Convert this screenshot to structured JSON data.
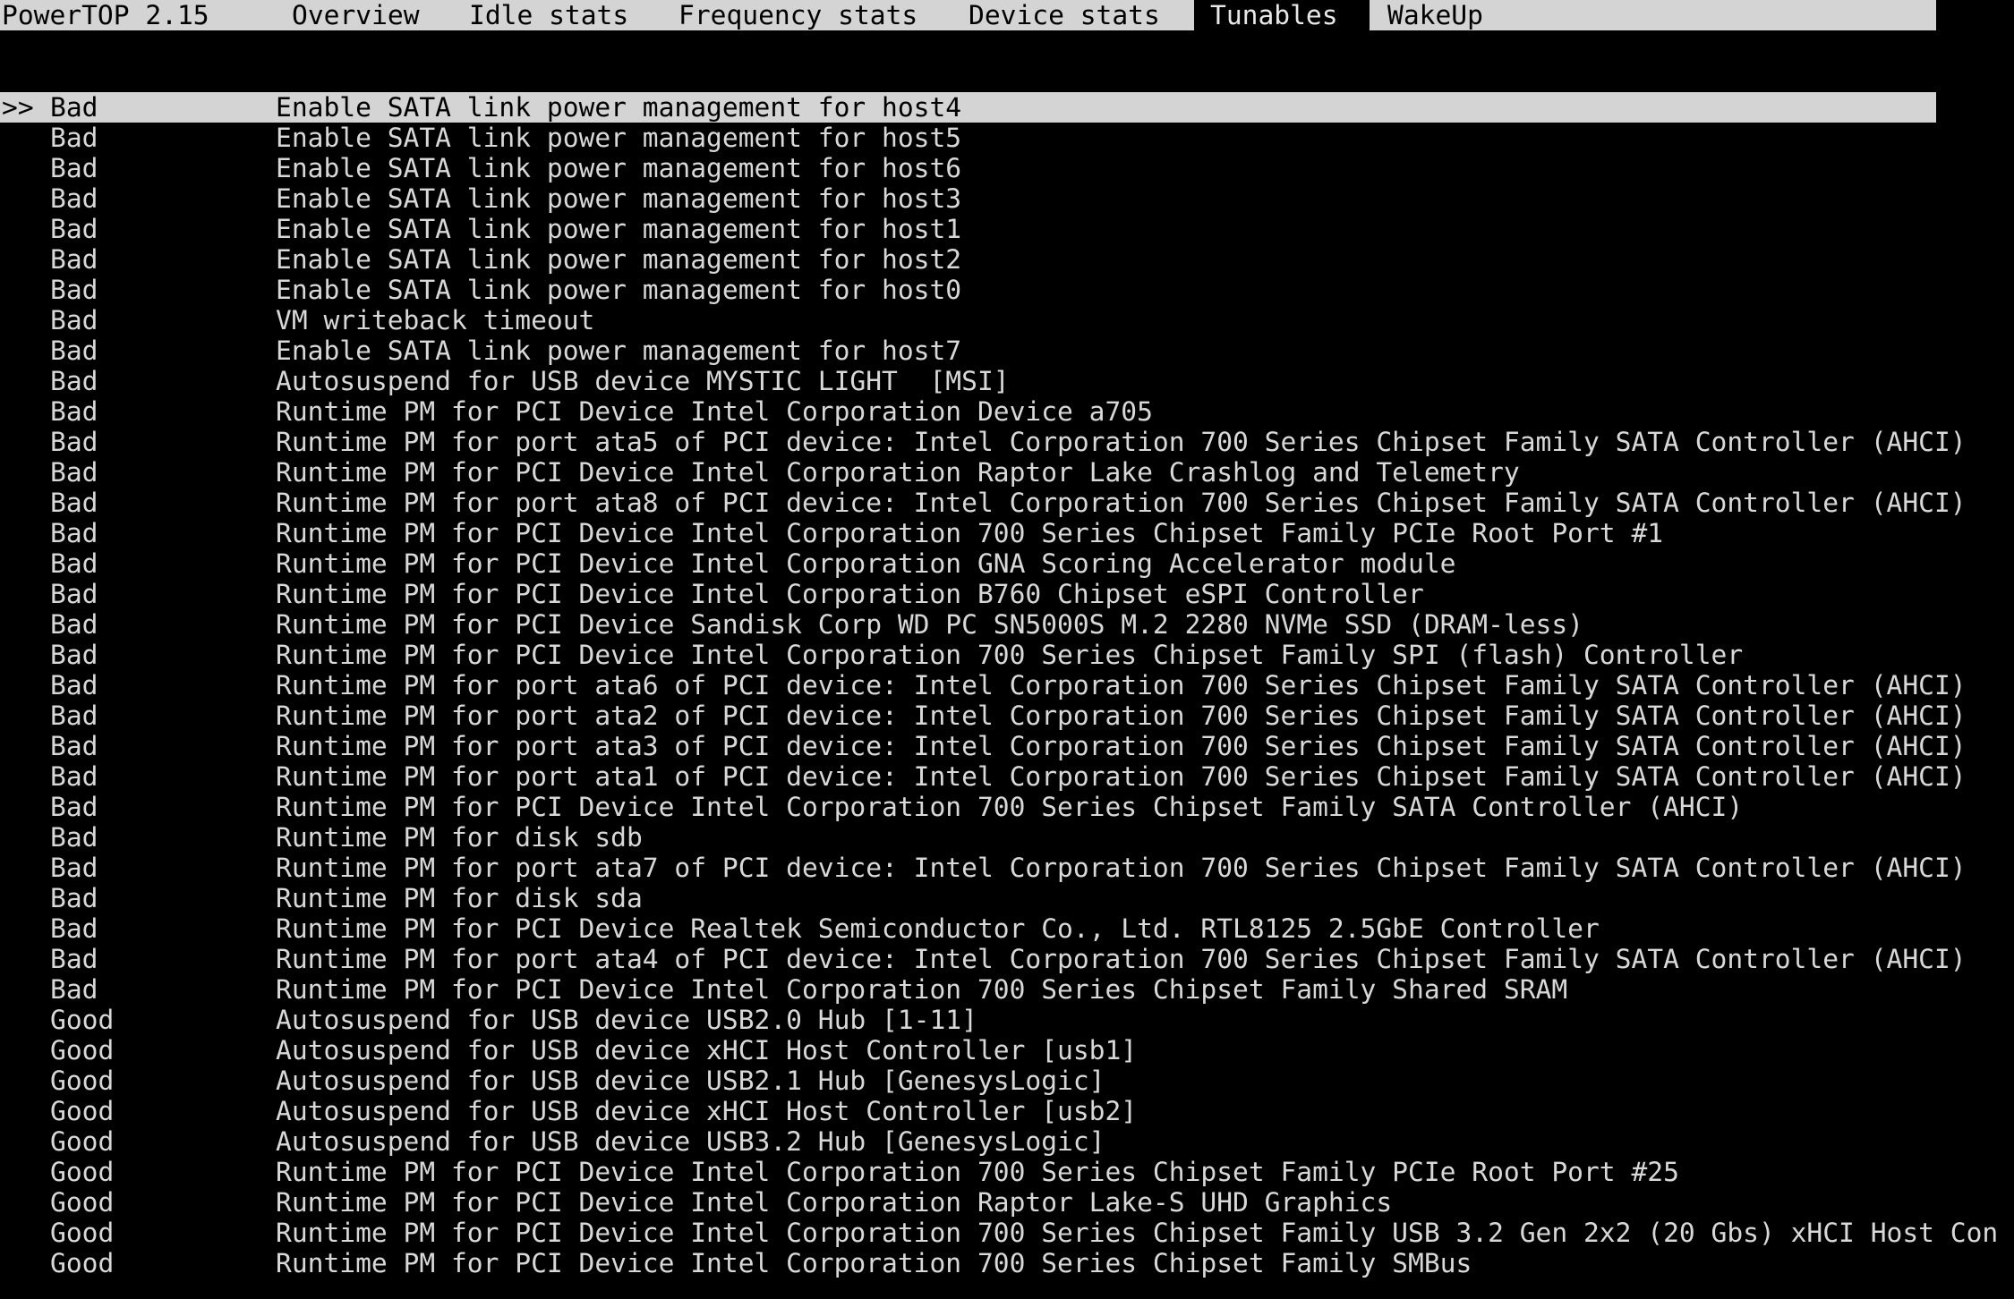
{
  "menubar": {
    "app_title": "PowerTOP 2.15",
    "tabs": [
      {
        "label": "Overview"
      },
      {
        "label": "Idle stats"
      },
      {
        "label": "Frequency stats"
      },
      {
        "label": "Device stats"
      },
      {
        "label": "Tunables",
        "active": true
      },
      {
        "label": "WakeUp"
      }
    ]
  },
  "tunables": {
    "cursor_marker": ">>",
    "selected_index": 0,
    "rows": [
      {
        "status": "Bad",
        "description": "Enable SATA link power management for host4"
      },
      {
        "status": "Bad",
        "description": "Enable SATA link power management for host5"
      },
      {
        "status": "Bad",
        "description": "Enable SATA link power management for host6"
      },
      {
        "status": "Bad",
        "description": "Enable SATA link power management for host3"
      },
      {
        "status": "Bad",
        "description": "Enable SATA link power management for host1"
      },
      {
        "status": "Bad",
        "description": "Enable SATA link power management for host2"
      },
      {
        "status": "Bad",
        "description": "Enable SATA link power management for host0"
      },
      {
        "status": "Bad",
        "description": "VM writeback timeout"
      },
      {
        "status": "Bad",
        "description": "Enable SATA link power management for host7"
      },
      {
        "status": "Bad",
        "description": "Autosuspend for USB device MYSTIC LIGHT  [MSI]"
      },
      {
        "status": "Bad",
        "description": "Runtime PM for PCI Device Intel Corporation Device a705"
      },
      {
        "status": "Bad",
        "description": "Runtime PM for port ata5 of PCI device: Intel Corporation 700 Series Chipset Family SATA Controller (AHCI)"
      },
      {
        "status": "Bad",
        "description": "Runtime PM for PCI Device Intel Corporation Raptor Lake Crashlog and Telemetry"
      },
      {
        "status": "Bad",
        "description": "Runtime PM for port ata8 of PCI device: Intel Corporation 700 Series Chipset Family SATA Controller (AHCI)"
      },
      {
        "status": "Bad",
        "description": "Runtime PM for PCI Device Intel Corporation 700 Series Chipset Family PCIe Root Port #1"
      },
      {
        "status": "Bad",
        "description": "Runtime PM for PCI Device Intel Corporation GNA Scoring Accelerator module"
      },
      {
        "status": "Bad",
        "description": "Runtime PM for PCI Device Intel Corporation B760 Chipset eSPI Controller"
      },
      {
        "status": "Bad",
        "description": "Runtime PM for PCI Device Sandisk Corp WD PC SN5000S M.2 2280 NVMe SSD (DRAM-less)"
      },
      {
        "status": "Bad",
        "description": "Runtime PM for PCI Device Intel Corporation 700 Series Chipset Family SPI (flash) Controller"
      },
      {
        "status": "Bad",
        "description": "Runtime PM for port ata6 of PCI device: Intel Corporation 700 Series Chipset Family SATA Controller (AHCI)"
      },
      {
        "status": "Bad",
        "description": "Runtime PM for port ata2 of PCI device: Intel Corporation 700 Series Chipset Family SATA Controller (AHCI)"
      },
      {
        "status": "Bad",
        "description": "Runtime PM for port ata3 of PCI device: Intel Corporation 700 Series Chipset Family SATA Controller (AHCI)"
      },
      {
        "status": "Bad",
        "description": "Runtime PM for port ata1 of PCI device: Intel Corporation 700 Series Chipset Family SATA Controller (AHCI)"
      },
      {
        "status": "Bad",
        "description": "Runtime PM for PCI Device Intel Corporation 700 Series Chipset Family SATA Controller (AHCI)"
      },
      {
        "status": "Bad",
        "description": "Runtime PM for disk sdb"
      },
      {
        "status": "Bad",
        "description": "Runtime PM for port ata7 of PCI device: Intel Corporation 700 Series Chipset Family SATA Controller (AHCI)"
      },
      {
        "status": "Bad",
        "description": "Runtime PM for disk sda"
      },
      {
        "status": "Bad",
        "description": "Runtime PM for PCI Device Realtek Semiconductor Co., Ltd. RTL8125 2.5GbE Controller"
      },
      {
        "status": "Bad",
        "description": "Runtime PM for port ata4 of PCI device: Intel Corporation 700 Series Chipset Family SATA Controller (AHCI)"
      },
      {
        "status": "Bad",
        "description": "Runtime PM for PCI Device Intel Corporation 700 Series Chipset Family Shared SRAM"
      },
      {
        "status": "Good",
        "description": "Autosuspend for USB device USB2.0 Hub [1-11]"
      },
      {
        "status": "Good",
        "description": "Autosuspend for USB device xHCI Host Controller [usb1]"
      },
      {
        "status": "Good",
        "description": "Autosuspend for USB device USB2.1 Hub [GenesysLogic]"
      },
      {
        "status": "Good",
        "description": "Autosuspend for USB device xHCI Host Controller [usb2]"
      },
      {
        "status": "Good",
        "description": "Autosuspend for USB device USB3.2 Hub [GenesysLogic]"
      },
      {
        "status": "Good",
        "description": "Runtime PM for PCI Device Intel Corporation 700 Series Chipset Family PCIe Root Port #25"
      },
      {
        "status": "Good",
        "description": "Runtime PM for PCI Device Intel Corporation Raptor Lake-S UHD Graphics"
      },
      {
        "status": "Good",
        "description": "Runtime PM for PCI Device Intel Corporation 700 Series Chipset Family USB 3.2 Gen 2x2 (20 Gbs) xHCI Host Con"
      },
      {
        "status": "Good",
        "description": "Runtime PM for PCI Device Intel Corporation 700 Series Chipset Family SMBus"
      }
    ]
  }
}
